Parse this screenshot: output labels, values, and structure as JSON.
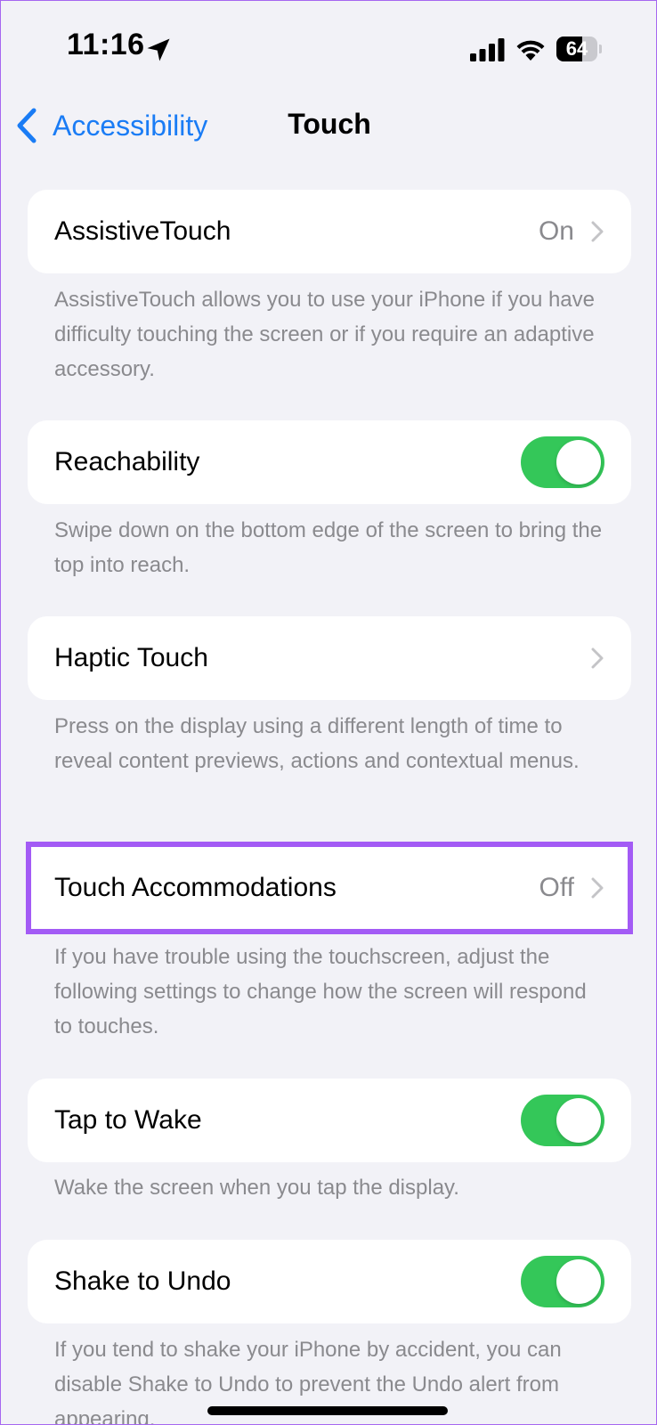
{
  "status_bar": {
    "time": "11:16",
    "battery_percent": "64",
    "battery_level": 0.64
  },
  "nav": {
    "back_label": "Accessibility",
    "title": "Touch"
  },
  "colors": {
    "accent": "#1a7cf5",
    "toggle_on": "#34c759",
    "highlight": "#a35bf5",
    "background": "#f2f2f7"
  },
  "rows": {
    "assistive_touch": {
      "label": "AssistiveTouch",
      "value": "On",
      "footer": "AssistiveTouch allows you to use your iPhone if you have difficulty touching the screen or if you require an adaptive accessory."
    },
    "reachability": {
      "label": "Reachability",
      "enabled": true,
      "footer": "Swipe down on the bottom edge of the screen to bring the top into reach."
    },
    "haptic_touch": {
      "label": "Haptic Touch",
      "footer": "Press on the display using a different length of time to reveal content previews, actions and contextual menus."
    },
    "touch_accommodations": {
      "label": "Touch Accommodations",
      "value": "Off",
      "footer": "If you have trouble using the touchscreen, adjust the following settings to change how the screen will respond to touches."
    },
    "tap_to_wake": {
      "label": "Tap to Wake",
      "enabled": true,
      "footer": "Wake the screen when you tap the display."
    },
    "shake_to_undo": {
      "label": "Shake to Undo",
      "enabled": true,
      "footer": "If you tend to shake your iPhone by accident, you can disable Shake to Undo to prevent the Undo alert from appearing."
    }
  }
}
